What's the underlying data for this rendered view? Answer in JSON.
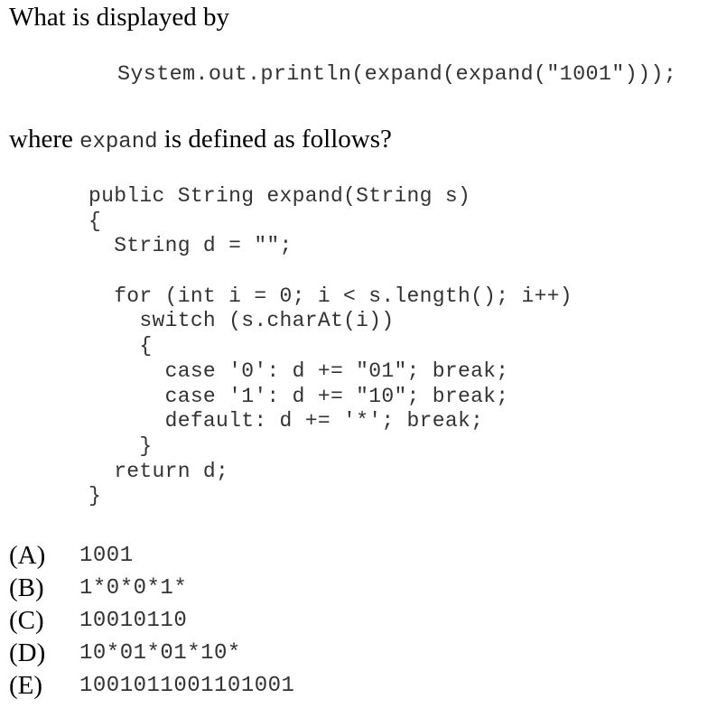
{
  "question": {
    "line1": "What is displayed by",
    "statement": "System.out.println(expand(expand(\"1001\")));",
    "line2_prefix": "where ",
    "line2_code": "expand",
    "line2_suffix": " is defined as follows?"
  },
  "code": [
    "public String expand(String s)",
    "{",
    "  String d = \"\";",
    "",
    "  for (int i = 0; i < s.length(); i++)",
    "    switch (s.charAt(i))",
    "    {",
    "      case '0': d += \"01\"; break;",
    "      case '1': d += \"10\"; break;",
    "      default: d += '*'; break;",
    "    }",
    "  return d;",
    "}"
  ],
  "choices": [
    {
      "label": "(A)",
      "value": "1001"
    },
    {
      "label": "(B)",
      "value": "1*0*0*1*"
    },
    {
      "label": "(C)",
      "value": "10010110"
    },
    {
      "label": "(D)",
      "value": "10*01*01*10*"
    },
    {
      "label": "(E)",
      "value": "1001011001101001"
    }
  ]
}
